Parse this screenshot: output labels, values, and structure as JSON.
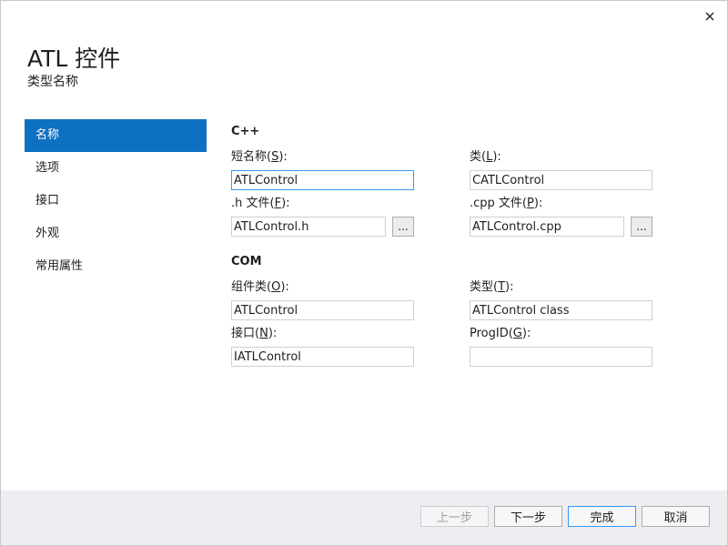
{
  "window": {
    "title": "ATL 控件",
    "subtitle": "类型名称",
    "close_icon": "close-icon"
  },
  "nav": {
    "items": [
      {
        "label": "名称",
        "active": true
      },
      {
        "label": "选项",
        "active": false
      },
      {
        "label": "接口",
        "active": false
      },
      {
        "label": "外观",
        "active": false
      },
      {
        "label": "常用属性",
        "active": false
      }
    ]
  },
  "cpp": {
    "heading": "C++",
    "short_name": {
      "label_pre": "短名称(",
      "mnemonic": "S",
      "label_post": "):",
      "value": "ATLControl"
    },
    "class": {
      "label_pre": "类(",
      "mnemonic": "L",
      "label_post": "):",
      "value": "CATLControl"
    },
    "h_file": {
      "label_pre": ".h 文件(",
      "mnemonic": "F",
      "label_post": "):",
      "value": "ATLControl.h"
    },
    "cpp_file": {
      "label_pre": ".cpp 文件(",
      "mnemonic": "P",
      "label_post": "):",
      "value": "ATLControl.cpp"
    },
    "browse_label": "..."
  },
  "com": {
    "heading": "COM",
    "coclass": {
      "label_pre": "组件类(",
      "mnemonic": "O",
      "label_post": "):",
      "value": "ATLControl"
    },
    "type": {
      "label_pre": "类型(",
      "mnemonic": "T",
      "label_post": "):",
      "value": "ATLControl class"
    },
    "interface": {
      "label_pre": "接口(",
      "mnemonic": "N",
      "label_post": "):",
      "value": "IATLControl"
    },
    "progid": {
      "label_pre": "ProgID(",
      "mnemonic": "G",
      "label_post": "):",
      "value": ""
    }
  },
  "footer": {
    "prev_label": "上一步",
    "next_label": "下一步",
    "finish_label": "完成",
    "cancel_label": "取消"
  },
  "colors": {
    "accent": "#0e70c0",
    "focus_border": "#3399ff",
    "footer_bg": "#eeeef2"
  }
}
